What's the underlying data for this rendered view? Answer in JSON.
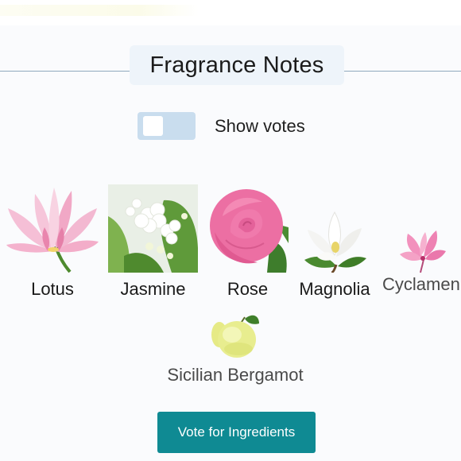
{
  "section": {
    "title": "Fragrance Notes"
  },
  "toggle": {
    "label": "Show votes",
    "on": false
  },
  "notes": [
    {
      "label": "Lotus",
      "icon": "lotus-icon"
    },
    {
      "label": "Jasmine",
      "icon": "jasmine-icon"
    },
    {
      "label": "Rose",
      "icon": "rose-icon"
    },
    {
      "label": "Magnolia",
      "icon": "magnolia-icon"
    },
    {
      "label": "Cyclamen",
      "icon": "cyclamen-icon"
    },
    {
      "label": "Sicilian Bergamot",
      "icon": "bergamot-icon"
    }
  ],
  "cta": {
    "label": "Vote for Ingredients"
  },
  "colors": {
    "accent": "#0f8a93",
    "toggle_track": "#c9ddee",
    "divider": "#8fa9bd",
    "title_bg": "#eef4fa"
  }
}
